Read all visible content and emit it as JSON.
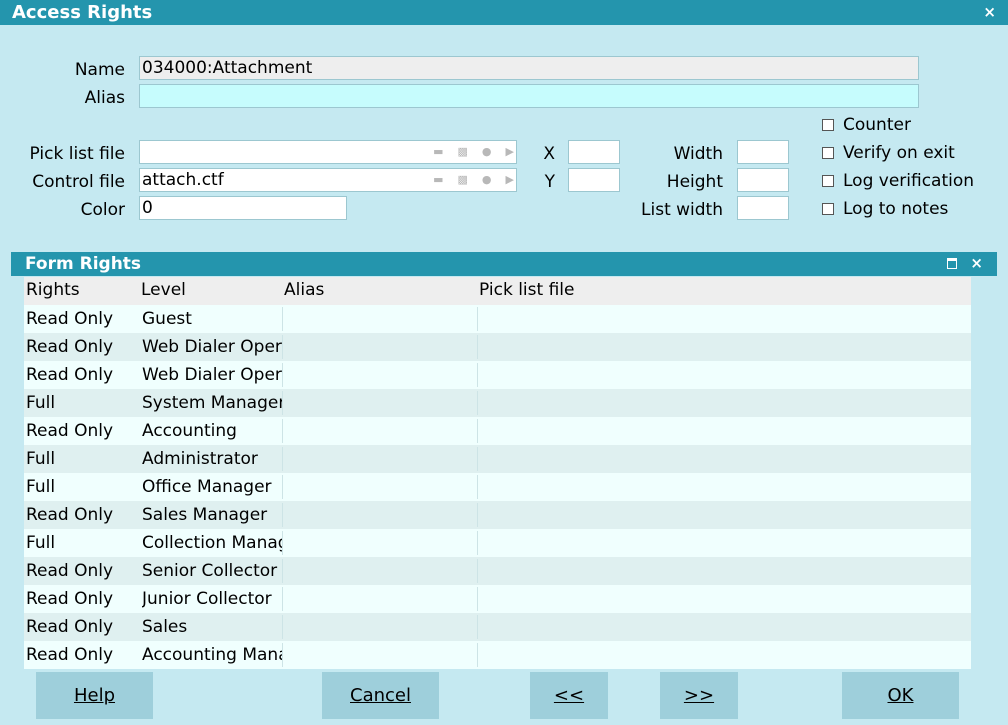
{
  "window": {
    "title": "Access Rights",
    "close": "×"
  },
  "form": {
    "name_label": "Name",
    "name_value": "034000:Attachment",
    "alias_label": "Alias",
    "alias_value": "",
    "pick_list_label": "Pick list file",
    "pick_list_value": "",
    "control_file_label": "Control file",
    "control_file_value": "attach.ctf",
    "color_label": "Color",
    "color_value": "0",
    "x_label": "X",
    "x_value": "",
    "y_label": "Y",
    "y_value": "",
    "width_label": "Width",
    "width_value": "",
    "height_label": "Height",
    "height_value": "",
    "list_width_label": "List width",
    "list_width_value": ""
  },
  "options": {
    "counter": "Counter",
    "verify_on_exit": "Verify on exit",
    "log_verification": "Log verification",
    "log_to_notes": "Log to notes"
  },
  "panel": {
    "title": "Form Rights",
    "close": "×"
  },
  "table": {
    "columns": [
      "Rights",
      "Level",
      "Alias",
      "Pick list file"
    ],
    "rows": [
      [
        "Read Only",
        "Guest",
        "",
        ""
      ],
      [
        "Read Only",
        "Web Dialer Oper",
        "",
        ""
      ],
      [
        "Read Only",
        "Web Dialer Oper",
        "",
        ""
      ],
      [
        "Full",
        "System Manager",
        "",
        ""
      ],
      [
        "Read Only",
        "Accounting",
        "",
        ""
      ],
      [
        "Full",
        "Administrator",
        "",
        ""
      ],
      [
        "Full",
        "Office Manager",
        "",
        ""
      ],
      [
        "Read Only",
        "Sales Manager",
        "",
        ""
      ],
      [
        "Full",
        "Collection Manag",
        "",
        ""
      ],
      [
        "Read Only",
        "Senior Collector",
        "",
        ""
      ],
      [
        "Read Only",
        "Junior Collector",
        "",
        ""
      ],
      [
        "Read Only",
        "Sales",
        "",
        ""
      ],
      [
        "Read Only",
        "Accounting Mana",
        "",
        ""
      ]
    ]
  },
  "buttons": {
    "help": "Help",
    "cancel": "Cancel",
    "prev": "<<",
    "next": ">>",
    "ok": "OK"
  },
  "icons": [
    "folder-icon",
    "print-icon",
    "clear-icon",
    "lookup-icon"
  ],
  "colors": {
    "titlebar": "#2495ad",
    "background": "#c5e9f1",
    "button": "#9ecfdb"
  }
}
